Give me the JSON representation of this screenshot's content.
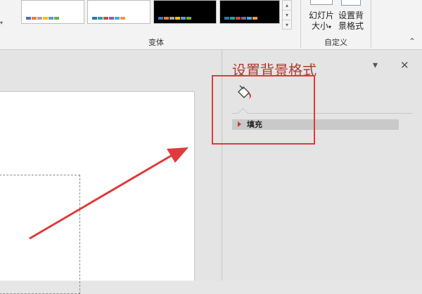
{
  "ribbon": {
    "variants_group_label": "变体",
    "custom_group_label": "自定义",
    "slide_size_label_line1": "幻灯片",
    "slide_size_label_line2": "大小",
    "slide_size_dropdown": "▾",
    "format_bg_label_line1": "设置背",
    "format_bg_label_line2": "景格式",
    "variant_thumbnails": [
      {
        "background": "white",
        "swatches": [
          "#4472c4",
          "#ed7d31",
          "#a5a5a5",
          "#ffc000",
          "#5b9bd5",
          "#70ad47"
        ]
      },
      {
        "background": "white",
        "swatches": [
          "#2e75b6",
          "#2aa198",
          "#c0504d",
          "#8064a2",
          "#4bacc6",
          "#f79646"
        ]
      },
      {
        "background": "black",
        "swatches": [
          "#4472c4",
          "#ed7d31",
          "#a5a5a5",
          "#ffc000",
          "#5b9bd5",
          "#70ad47"
        ]
      },
      {
        "background": "black",
        "swatches": [
          "#2e75b6",
          "#2aa198",
          "#c0504d",
          "#8064a2",
          "#4bacc6",
          "#f79646"
        ]
      }
    ],
    "spin_icons": [
      "chevron-up-icon",
      "chevron-down-icon",
      "more-icon"
    ]
  },
  "pane": {
    "title": "设置背景格式",
    "menu_glyph": "▾",
    "close_glyph": "✕",
    "section_label": "填充",
    "icon": "paint-bucket-icon"
  },
  "colors": {
    "title": "#b03a2e",
    "highlight": "#e03a3a",
    "arrow": "#e03a3a",
    "section_bg": "#c9c9c9"
  }
}
